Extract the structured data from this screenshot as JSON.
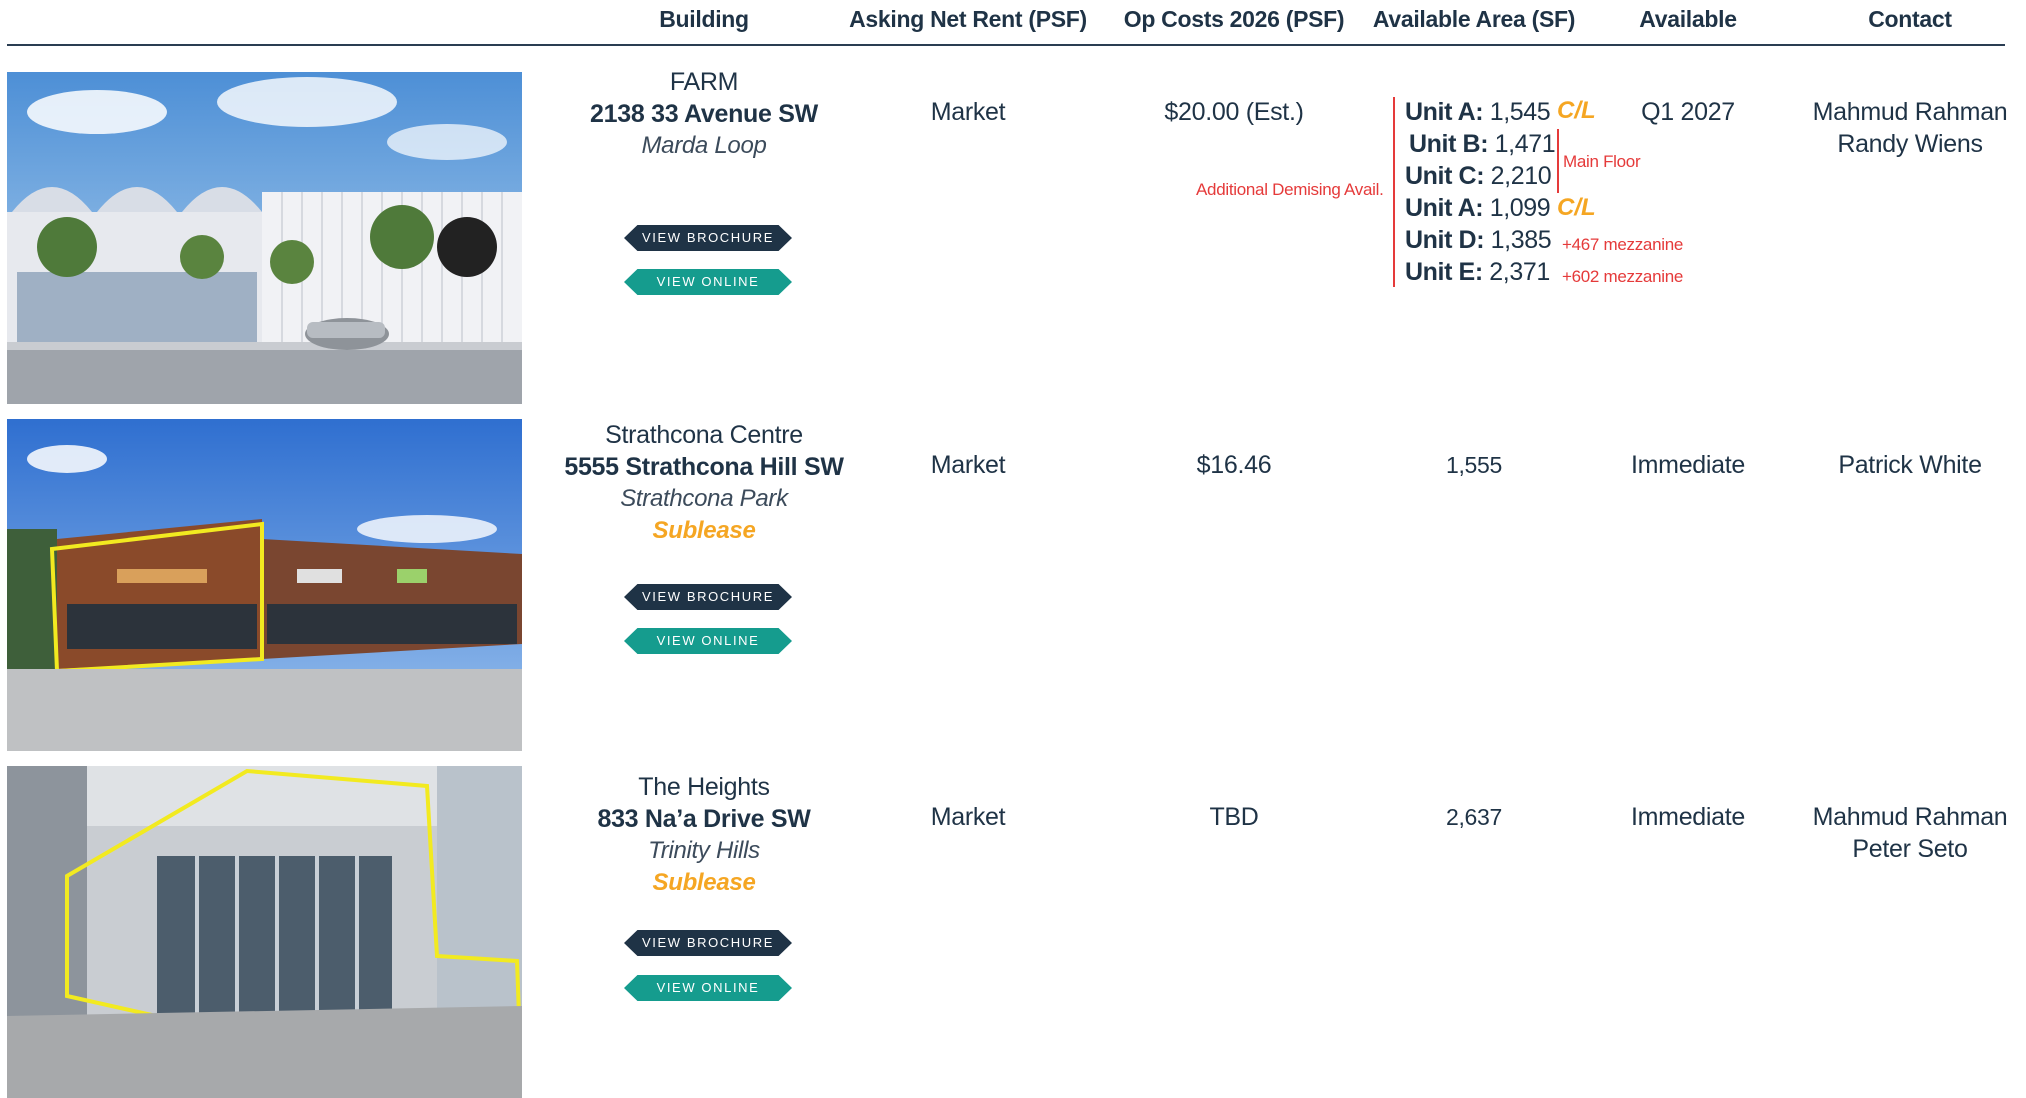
{
  "headers": {
    "building": "Building",
    "rent": "Asking Net Rent (PSF)",
    "opcosts": "Op Costs 2026 (PSF)",
    "area": "Available Area (SF)",
    "available": "Available",
    "contact": "Contact"
  },
  "buttons": {
    "brochure": "VIEW BROCHURE",
    "online": "VIEW ONLINE"
  },
  "colors": {
    "navy": "#1f3346",
    "teal": "#159c8e",
    "orange": "#f5a623",
    "red": "#e53a3a"
  },
  "listings": [
    {
      "name": "FARM",
      "address": "2138 33 Avenue SW",
      "area": "Marda Loop",
      "sublease": "",
      "rent": "Market",
      "opcosts": "$20.00 (Est.)",
      "opcosts_note": "Additional Demising Avail.",
      "available": "Q1 2027",
      "contact1": "Mahmud Rahman",
      "contact2": "Randy Wiens",
      "units": [
        {
          "label": "Unit A:",
          "size": "1,545",
          "tag": "C/L",
          "note": ""
        },
        {
          "label": "Unit B:",
          "size": "1,471",
          "tag": "",
          "note": ""
        },
        {
          "label": "Unit C:",
          "size": "2,210",
          "tag": "",
          "note": ""
        },
        {
          "label": "Unit A:",
          "size": "1,099",
          "tag": "C/L",
          "note": ""
        },
        {
          "label": "Unit D:",
          "size": "1,385",
          "tag": "",
          "note": "+467 mezzanine"
        },
        {
          "label": "Unit E:",
          "size": "2,371",
          "tag": "",
          "note": "+602 mezzanine"
        }
      ],
      "main_floor": "Main Floor",
      "photo": "farm-building-photo"
    },
    {
      "name": "Strathcona Centre",
      "address": "5555 Strathcona Hill SW",
      "area": "Strathcona Park",
      "sublease": "Sublease",
      "rent": "Market",
      "opcosts": "$16.46",
      "size": "1,555",
      "available": "Immediate",
      "contact1": "Patrick White",
      "contact2": "",
      "photo": "strathcona-centre-photo"
    },
    {
      "name": "The Heights",
      "address": "833 Na’a Drive SW",
      "area": "Trinity Hills",
      "sublease": "Sublease",
      "rent": "Market",
      "opcosts": "TBD",
      "size": "2,637",
      "available": "Immediate",
      "contact1": "Mahmud Rahman",
      "contact2": "Peter Seto",
      "photo": "the-heights-photo"
    }
  ]
}
